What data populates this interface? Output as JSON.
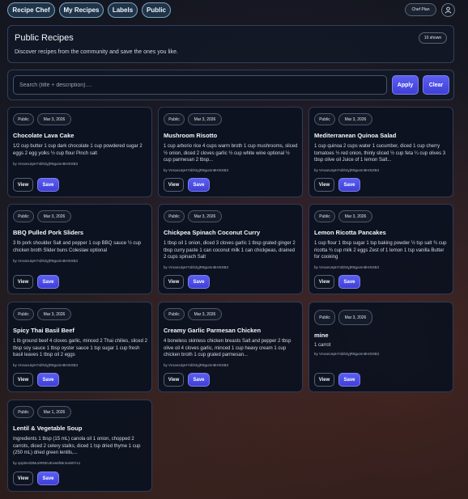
{
  "nav": {
    "items": [
      {
        "label": "Recipe Chef"
      },
      {
        "label": "My Recipes"
      },
      {
        "label": "Labels"
      },
      {
        "label": "Public"
      }
    ],
    "plan_label": "Chef Plan",
    "user_icon": "user-icon"
  },
  "header": {
    "title": "Public Recipes",
    "subtitle": "Discover recipes from the community and save the ones you like.",
    "count": "10 shown"
  },
  "search": {
    "placeholder": "Search (title + description)....",
    "value": "",
    "apply_label": "Apply",
    "clear_label": "Clear"
  },
  "recipes": [
    {
      "visibility": "Public",
      "date": "Mar 3, 2026",
      "title": "Chocolate Lava Cake",
      "description": "1/2 cup butter 1 cup dark chocolate 1 cup powdered sugar 2 eggs 2 egg yolks ½ cup flour Pinch salt",
      "author": "by VnsxeL6pH7xbh3yjR9gumn8Hr5XB3",
      "view_label": "View",
      "save_label": "Save"
    },
    {
      "visibility": "Public",
      "date": "Mar 3, 2026",
      "title": "Mushroom Risotto",
      "description": "1 cup arborio rice 4 cups warm broth 1 cup mushrooms, sliced ½ onion, diced 2 cloves garlic ½ cup white wine optional ½ cup parmesan 2 tbsp...",
      "author": "by VnsxeL6pH7xbh3yjR9gumn8Hr5XB3",
      "view_label": "View",
      "save_label": "Save"
    },
    {
      "visibility": "Public",
      "date": "Mar 3, 2026",
      "title": "Mediterranean Quinoa Salad",
      "description": "1 cup quinoa 2 cups water 1 cucumber, diced 1 cup cherry tomatoes ½ red onion, thinly sliced ½ cup feta ¼ cup olives 3 tbsp olive oil Juice of 1 lemon Salt...",
      "author": "by VnsxeL6pH7xbh3yjR9gumn8Hr5XB3",
      "view_label": "View",
      "save_label": "Save"
    },
    {
      "visibility": "Public",
      "date": "Mar 3, 2026",
      "title": "BBQ Pulled Pork Sliders",
      "description": "3 lb pork shoulder Salt and pepper 1 cup BBQ sauce ½ cup chicken broth Slider buns Coleslaw optional",
      "author": "by VnsxeL6pH7xbh3yjR9gumn8Hr5XB3",
      "view_label": "View",
      "save_label": "Save"
    },
    {
      "visibility": "Public",
      "date": "Mar 3, 2026",
      "title": "Chickpea Spinach Coconut Curry",
      "description": "1 tbsp oil 1 onion, diced 3 cloves garlic 1 tbsp grated ginger 2 tbsp curry paste 1 can coconut milk 1 can chickpeas, drained 2 cups spinach Salt",
      "author": "by VnsxeL6pH7xbh3yjR9gumn8Hr5XB3",
      "view_label": "View",
      "save_label": "Save"
    },
    {
      "visibility": "Public",
      "date": "Mar 3, 2026",
      "title": "Lemon Ricotta Pancakes",
      "description": "1 cup flour 1 tbsp sugar 1 tsp baking powder ½ tsp salt ¾ cup ricotta ¾ cup milk 2 eggs Zest of 1 lemon 1 tsp vanilla Butter for cooking",
      "author": "by VnsxeL6pH7xbh3yjR9gumn8Hr5XB3",
      "view_label": "View",
      "save_label": "Save"
    },
    {
      "visibility": "Public",
      "date": "Mar 3, 2026",
      "title": "Spicy Thai Basil Beef",
      "description": "1 lb ground beef 4 cloves garlic, minced 2 Thai chilies, sliced 2 tbsp soy sauce 1 tbsp oyster sauce 1 tsp sugar 1 cup fresh basil leaves 1 tbsp oil 2 eggs",
      "author": "by VnsxeL6pH7xbh3yjR9gumn8Hr5XB3",
      "view_label": "View",
      "save_label": "Save"
    },
    {
      "visibility": "Public",
      "date": "Mar 3, 2026",
      "title": "Creamy Garlic Parmesan Chicken",
      "description": "4 boneless skinless chicken breasts Salt and pepper 2 tbsp olive oil 4 cloves garlic, minced 1 cup heavy cream 1 cup chicken broth 1 cup grated parmesan...",
      "author": "by VnsxeL6pH7xbh3yjR9gumn8Hr5XB3",
      "view_label": "View",
      "save_label": "Save"
    },
    {
      "visibility": "Public",
      "date": "Mar 3, 2026",
      "title": "mine",
      "description": "1 carrot",
      "author": "by VnsxeL6pH7xbh3yjR9gumn8Hr5XB3",
      "view_label": "View",
      "save_label": "Save"
    },
    {
      "visibility": "Public",
      "date": "Mar 1, 2026",
      "title": "Lentil & Vegetable Soup",
      "description": "Ingredients 1 tbsp (15 mL) canola oil 1 onion, chopped 2 carrots, diced 2 celery stalks, diced 1 tsp dried thyme 1 cup (250 mL) dried green lentils,...",
      "author": "by qnp5nnl3MuSR0EUEvw6hBnnaN0Yx1",
      "view_label": "View",
      "save_label": "Save"
    }
  ]
}
